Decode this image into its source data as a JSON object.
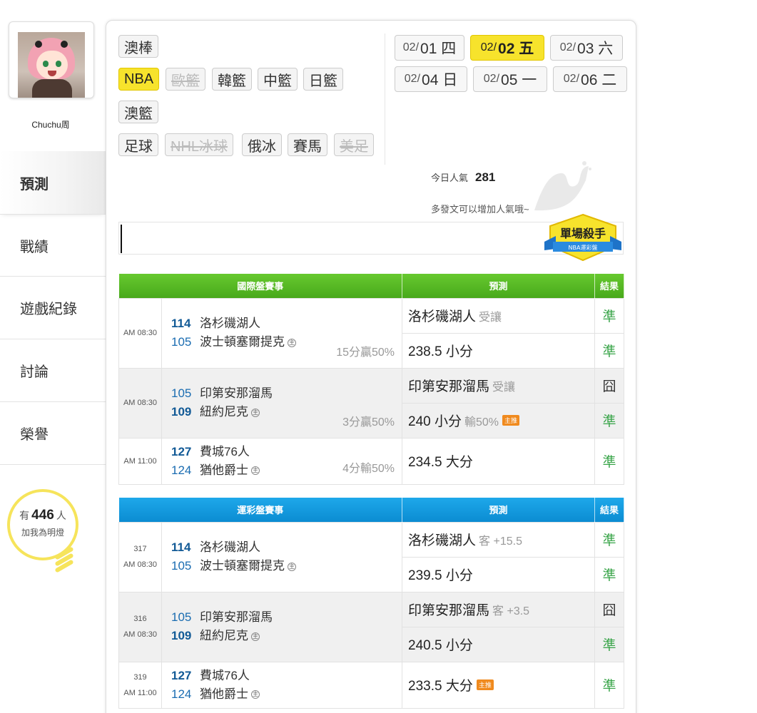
{
  "user": {
    "name": "Chuchu周"
  },
  "nav": {
    "items": [
      "預測",
      "戰績",
      "遊戲紀錄",
      "討論",
      "榮譽"
    ]
  },
  "fans": {
    "prefix": "有",
    "count": "446",
    "suffix": "人",
    "line2": "加我為明燈"
  },
  "sports": [
    {
      "label": "澳棒",
      "state": "normal"
    },
    {
      "label": "NBA",
      "state": "active"
    },
    {
      "label": "歐籃",
      "state": "disabled"
    },
    {
      "label": "韓籃",
      "state": "normal"
    },
    {
      "label": "中籃",
      "state": "normal"
    },
    {
      "label": "日籃",
      "state": "normal"
    },
    {
      "label": "澳籃",
      "state": "normal"
    },
    {
      "label": "足球",
      "state": "normal"
    },
    {
      "label": "NHL冰球",
      "state": "disabled"
    },
    {
      "label": "俄冰",
      "state": "normal"
    },
    {
      "label": "賽馬",
      "state": "normal"
    },
    {
      "label": "美足",
      "state": "disabled"
    }
  ],
  "dates": [
    {
      "md": "02/",
      "day": "01 四",
      "active": false
    },
    {
      "md": "02/",
      "day": "02 五",
      "active": true
    },
    {
      "md": "02/",
      "day": "03 六",
      "active": false
    },
    {
      "md": "02/",
      "day": "04 日",
      "active": false
    },
    {
      "md": "02/",
      "day": "05 一",
      "active": false
    },
    {
      "md": "02/",
      "day": "06 二",
      "active": false
    }
  ],
  "popularity": {
    "label": "今日人氣",
    "value": "281",
    "hint": "多發文可以增加人氣哦~"
  },
  "badge": {
    "title": "單場殺手",
    "subtitle": "NBA運彩盤"
  },
  "home_mark": "主",
  "main_tag": "主推",
  "intl_table": {
    "headers": [
      "國際盤賽事",
      "預測",
      "結果"
    ],
    "games": [
      {
        "time": "AM 08:30",
        "team1": {
          "score": "114",
          "name": "洛杉磯湖人"
        },
        "team2": {
          "score": "105",
          "name": "波士頓塞爾提克"
        },
        "handicap": "15分贏50%",
        "preds": [
          {
            "main": "洛杉磯湖人",
            "extra": "受讓",
            "result": "準"
          },
          {
            "main": "238.5 小分",
            "extra": "",
            "result": "準"
          }
        ]
      },
      {
        "time": "AM 08:30",
        "team1": {
          "score": "105",
          "name": "印第安那溜馬"
        },
        "team2": {
          "score": "109",
          "name": "紐約尼克"
        },
        "handicap": "3分贏50%",
        "preds": [
          {
            "main": "印第安那溜馬",
            "extra": "受讓",
            "result": "囧"
          },
          {
            "main": "240 小分",
            "extra": "輸50%",
            "result": "準"
          }
        ]
      },
      {
        "time": "AM 11:00",
        "team1": {
          "score": "127",
          "name": "費城76人"
        },
        "team2": {
          "score": "124",
          "name": "猶他爵士"
        },
        "handicap": "4分輸50%",
        "preds": [
          {
            "main": "234.5 大分",
            "extra": "",
            "result": "準"
          }
        ]
      }
    ]
  },
  "lottery_table": {
    "headers": [
      "運彩盤賽事",
      "預測",
      "結果"
    ],
    "games": [
      {
        "code": "317",
        "time": "AM 08:30",
        "team1": {
          "score": "114",
          "name": "洛杉磯湖人"
        },
        "team2": {
          "score": "105",
          "name": "波士頓塞爾提克"
        },
        "preds": [
          {
            "main": "洛杉磯湖人",
            "extra": "客 +15.5",
            "result": "準"
          },
          {
            "main": "239.5 小分",
            "extra": "",
            "result": "準"
          }
        ]
      },
      {
        "code": "316",
        "time": "AM 08:30",
        "team1": {
          "score": "105",
          "name": "印第安那溜馬"
        },
        "team2": {
          "score": "109",
          "name": "紐約尼克"
        },
        "preds": [
          {
            "main": "印第安那溜馬",
            "extra": "客 +3.5",
            "result": "囧"
          },
          {
            "main": "240.5 小分",
            "extra": "",
            "result": "準"
          }
        ]
      },
      {
        "code": "319",
        "time": "AM 11:00",
        "team1": {
          "score": "127",
          "name": "費城76人"
        },
        "team2": {
          "score": "124",
          "name": "猶他爵士"
        },
        "preds": [
          {
            "main": "233.5 大分",
            "extra": "",
            "result": "準"
          }
        ]
      }
    ]
  }
}
